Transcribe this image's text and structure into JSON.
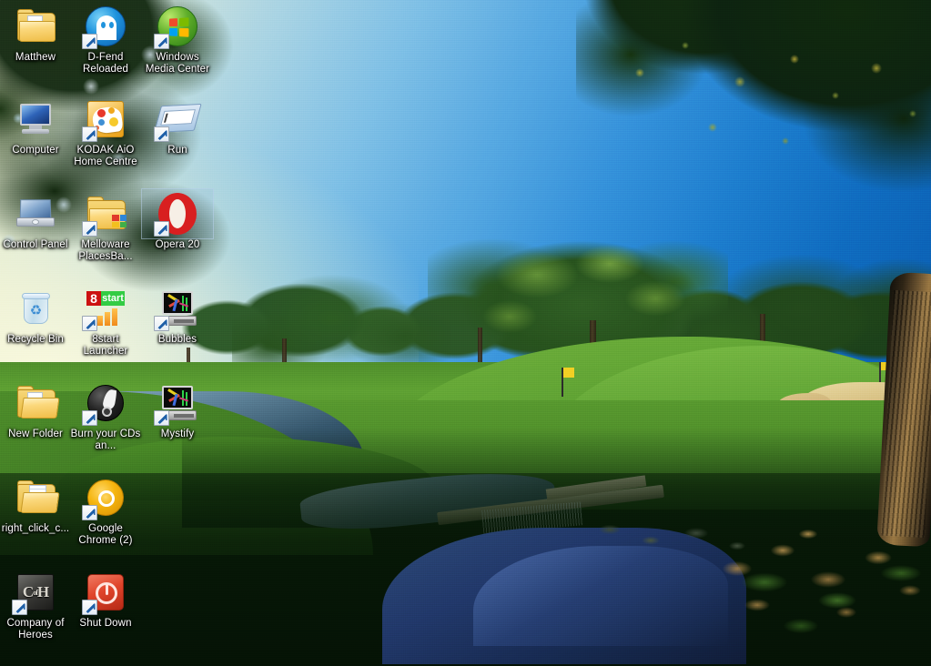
{
  "desktop": {
    "wallpaper_description": "Golf course photograph at golden hour with pond, waterfall weir, fairway, sand bunker and large trees",
    "wallpaper_colors": {
      "sky_light": "#f6f3d8",
      "sky_deep": "#0a5eb2",
      "fairway_green": "#5fa233",
      "shadow_green": "#0a2208",
      "water_blue": "#21386a",
      "sand": "#d8c183",
      "flag_yellow": "#f2d024",
      "trunk_brown": "#9a7843"
    }
  },
  "icons": [
    {
      "id": "matthew",
      "name": "Matthew",
      "art": "folder-user",
      "shortcut": false,
      "selected": false,
      "col": 0,
      "row": 0
    },
    {
      "id": "dfend",
      "name": "D-Fend Reloaded",
      "art": "dfend",
      "shortcut": true,
      "selected": false,
      "col": 1,
      "row": 0
    },
    {
      "id": "wmc",
      "name": "Windows Media Center",
      "art": "wmc",
      "shortcut": true,
      "selected": false,
      "col": 2,
      "row": 0
    },
    {
      "id": "computer",
      "name": "Computer",
      "art": "monitor",
      "shortcut": false,
      "selected": false,
      "col": 0,
      "row": 1
    },
    {
      "id": "kodak",
      "name": "KODAK AiO Home Centre",
      "art": "kodak",
      "shortcut": true,
      "selected": false,
      "col": 1,
      "row": 1
    },
    {
      "id": "run",
      "name": "Run",
      "art": "run",
      "shortcut": true,
      "selected": false,
      "col": 2,
      "row": 1
    },
    {
      "id": "controlpanel",
      "name": "Control Panel",
      "art": "control-panel",
      "shortcut": false,
      "selected": false,
      "col": 0,
      "row": 2
    },
    {
      "id": "melloware",
      "name": "Melloware PlacesBa...",
      "art": "folder-melloware",
      "shortcut": true,
      "selected": false,
      "col": 1,
      "row": 2
    },
    {
      "id": "opera",
      "name": "Opera 20",
      "art": "opera",
      "shortcut": true,
      "selected": true,
      "col": 2,
      "row": 2
    },
    {
      "id": "recyclebin",
      "name": "Recycle Bin",
      "art": "recycle-bin",
      "shortcut": false,
      "selected": false,
      "col": 0,
      "row": 3
    },
    {
      "id": "8start",
      "name": "8start Launcher",
      "art": "eightstart",
      "shortcut": true,
      "selected": false,
      "col": 1,
      "row": 3
    },
    {
      "id": "bubbles",
      "name": "Bubbles",
      "art": "screensaver",
      "shortcut": true,
      "selected": false,
      "col": 2,
      "row": 3
    },
    {
      "id": "newfolder",
      "name": "New Folder",
      "art": "folder-open",
      "shortcut": false,
      "selected": false,
      "col": 0,
      "row": 4
    },
    {
      "id": "burncds",
      "name": "Burn your CDs an...",
      "art": "disc-burn",
      "shortcut": true,
      "selected": false,
      "col": 1,
      "row": 4
    },
    {
      "id": "mystify",
      "name": "Mystify",
      "art": "screensaver",
      "shortcut": true,
      "selected": false,
      "col": 2,
      "row": 4
    },
    {
      "id": "rightclick",
      "name": "right_click_c...",
      "art": "folder-docs",
      "shortcut": false,
      "selected": false,
      "col": 0,
      "row": 5
    },
    {
      "id": "chrome",
      "name": "Google Chrome (2)",
      "art": "chrome",
      "shortcut": true,
      "selected": false,
      "col": 1,
      "row": 5
    },
    {
      "id": "companyofheroes",
      "name": "Company of Heroes",
      "art": "coh",
      "shortcut": true,
      "selected": false,
      "col": 0,
      "row": 6
    },
    {
      "id": "shutdown",
      "name": "Shut Down",
      "art": "power",
      "shortcut": true,
      "selected": false,
      "col": 1,
      "row": 6
    }
  ],
  "coh_text": {
    "c": "C",
    "of": "of",
    "h": "H"
  },
  "eightstart_text": {
    "digit": "8",
    "word": "start"
  }
}
